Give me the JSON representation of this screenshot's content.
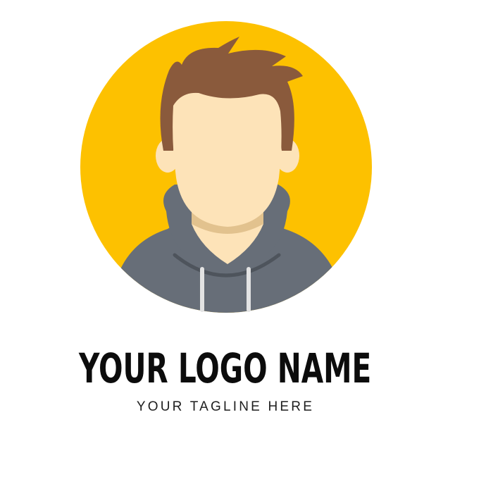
{
  "logo": {
    "name": "YOUR LOGO NAME",
    "tagline": "YOUR TAGLINE HERE"
  },
  "colors": {
    "circle": "#FDC100",
    "hair": "#8A5A3C",
    "skin": "#FDE3B8",
    "neck_shadow": "#E2C28E",
    "hoodie": "#676E78",
    "hoodie_dark": "#4E545C",
    "drawstring": "#E3E3E3",
    "text": "#0C0C0C"
  },
  "icons": {
    "avatar": "person-avatar-icon"
  }
}
